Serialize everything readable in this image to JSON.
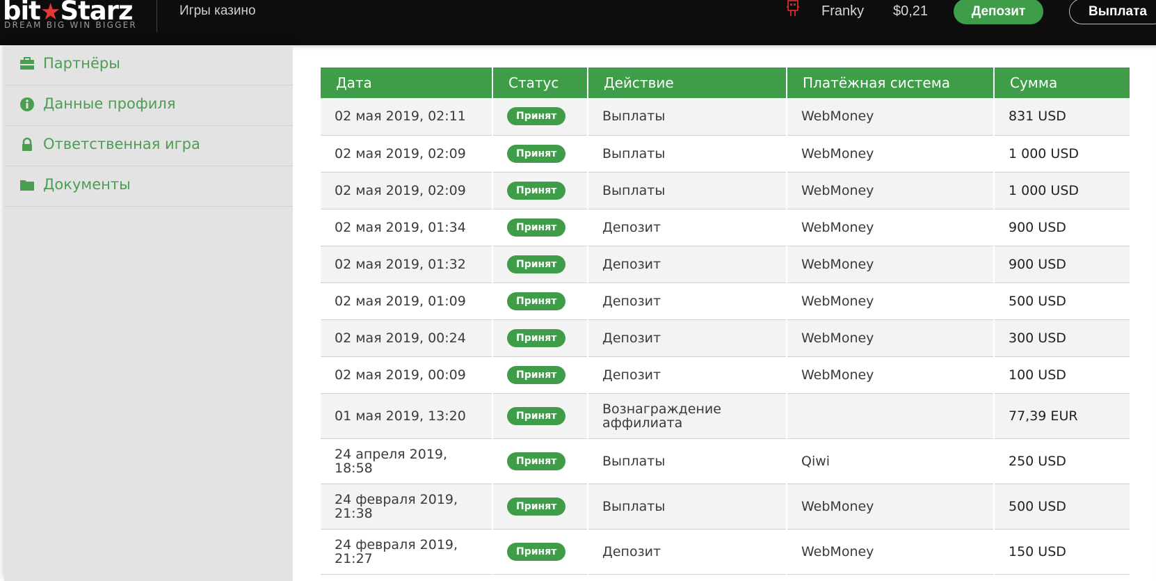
{
  "header": {
    "logo_left": "bit",
    "logo_star": "★",
    "logo_right": "Starz",
    "tagline": "DREAM BIG  WIN BIGGER",
    "nav_games": "Игры казино",
    "username": "Franky",
    "balance": "$0,21",
    "deposit_label": "Депозит",
    "withdraw_label": "Выплата"
  },
  "sidebar": {
    "items": [
      {
        "label": "Партнёры",
        "icon": "briefcase-icon"
      },
      {
        "label": "Данные профиля",
        "icon": "info-icon"
      },
      {
        "label": "Ответственная игра",
        "icon": "lock-icon"
      },
      {
        "label": "Документы",
        "icon": "folder-icon"
      }
    ]
  },
  "table": {
    "headers": [
      "Дата",
      "Статус",
      "Действие",
      "Платёжная система",
      "Сумма"
    ],
    "rows": [
      {
        "date": "02 мая 2019, 02:11",
        "status": "Принят",
        "action": "Выплаты",
        "system": "WebMoney",
        "amount": "831 USD"
      },
      {
        "date": "02 мая 2019, 02:09",
        "status": "Принят",
        "action": "Выплаты",
        "system": "WebMoney",
        "amount": "1 000 USD"
      },
      {
        "date": "02 мая 2019, 02:09",
        "status": "Принят",
        "action": "Выплаты",
        "system": "WebMoney",
        "amount": "1 000 USD"
      },
      {
        "date": "02 мая 2019, 01:34",
        "status": "Принят",
        "action": "Депозит",
        "system": "WebMoney",
        "amount": "900 USD"
      },
      {
        "date": "02 мая 2019, 01:32",
        "status": "Принят",
        "action": "Депозит",
        "system": "WebMoney",
        "amount": "900 USD"
      },
      {
        "date": "02 мая 2019, 01:09",
        "status": "Принят",
        "action": "Депозит",
        "system": "WebMoney",
        "amount": "500 USD"
      },
      {
        "date": "02 мая 2019, 00:24",
        "status": "Принят",
        "action": "Депозит",
        "system": "WebMoney",
        "amount": "300 USD"
      },
      {
        "date": "02 мая 2019, 00:09",
        "status": "Принят",
        "action": "Депозит",
        "system": "WebMoney",
        "amount": "100 USD"
      },
      {
        "date": "01 мая 2019, 13:20",
        "status": "Принят",
        "action": "Вознаграждение аффилиата",
        "system": "",
        "amount": "77,39 EUR"
      },
      {
        "date": "24 апреля 2019, 18:58",
        "status": "Принят",
        "action": "Выплаты",
        "system": "Qiwi",
        "amount": "250 USD"
      },
      {
        "date": "24 февраля 2019, 21:38",
        "status": "Принят",
        "action": "Выплаты",
        "system": "WebMoney",
        "amount": "500 USD"
      },
      {
        "date": "24 февраля 2019, 21:27",
        "status": "Принят",
        "action": "Депозит",
        "system": "WebMoney",
        "amount": "150 USD"
      }
    ]
  },
  "colors": {
    "accent_green": "#3f9d4a",
    "header_bg": "#0d0d0d",
    "logo_star": "#e53935",
    "sidebar_bg": "#e3e3e3"
  }
}
